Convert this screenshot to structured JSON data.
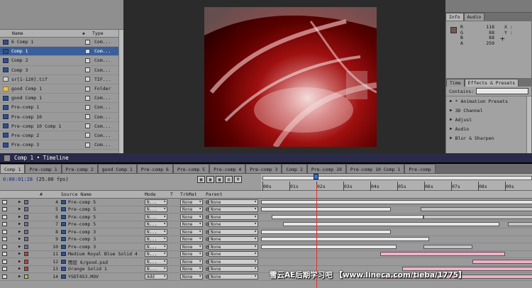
{
  "project": {
    "columns": {
      "name": "Name",
      "type": "Type"
    },
    "items": [
      {
        "name": "6 Comp 1",
        "type": "Com...",
        "icon": "comp-icon"
      },
      {
        "name": "Comp 1",
        "type": "Com...",
        "icon": "comp-icon"
      },
      {
        "name": "Comp 2",
        "type": "Com...",
        "icon": "comp-icon"
      },
      {
        "name": "Comp 3",
        "type": "Com...",
        "icon": "comp-icon"
      },
      {
        "name": "sr[1-120].tif",
        "type": "TIF...",
        "icon": "image-sequence-icon"
      },
      {
        "name": "good Comp 1",
        "type": "Folder",
        "icon": "folder-icon"
      },
      {
        "name": "good Comp 1",
        "type": "Com...",
        "icon": "comp-icon"
      },
      {
        "name": "Pre-comp 1",
        "type": "Com...",
        "icon": "comp-icon"
      },
      {
        "name": "Pre-comp 10",
        "type": "Com...",
        "icon": "comp-icon"
      },
      {
        "name": "Pre-comp 10 Comp 1",
        "type": "Com...",
        "icon": "comp-icon"
      },
      {
        "name": "Pre-comp 2",
        "type": "Com...",
        "icon": "comp-icon"
      },
      {
        "name": "Pre-comp 3",
        "type": "Com...",
        "icon": "comp-icon"
      }
    ]
  },
  "info": {
    "tabs": [
      "Info",
      "Audio"
    ],
    "values": [
      {
        "label": "R",
        "value": "118"
      },
      {
        "label": "G",
        "value": "88"
      },
      {
        "label": "B",
        "value": "88"
      },
      {
        "label": "A",
        "value": "250"
      }
    ],
    "x_label": "X :",
    "y_label": "Y :",
    "swatch_color": "#76584c"
  },
  "effects": {
    "tabs": [
      "Time",
      "Effects & Presets"
    ],
    "contains_label": "Contains:",
    "items": [
      "* Animation Presets",
      "3D Channel",
      "Adjust",
      "Audio",
      "Blur & Sharpen"
    ]
  },
  "timeline": {
    "title": "Comp 1 • Timeline",
    "tabs": [
      "Comp 1",
      "Pre-comp 1",
      "Pre-comp 2",
      "good Comp 1",
      "Pre-comp 6",
      "Pre-comp 5",
      "Pre-comp 4",
      "Pre-comp 3",
      "Comp 2",
      "Pre-comp 10",
      "Pre-comp 10 Comp 1",
      "Pre-comp"
    ],
    "timecode": "0:00:01:28",
    "fps": "(25.00 fps)",
    "ruler": [
      "00s",
      "01s",
      "02s",
      "03s",
      "04s",
      "05s",
      "06s",
      "07s",
      "08s",
      "09s"
    ],
    "columns": {
      "num": "#",
      "source": "Source Name",
      "mode": "Mode",
      "t": "T",
      "trkmat": "TrkMat",
      "parent": "Parent"
    },
    "layers": [
      {
        "num": "4",
        "name": "Pre-comp 5",
        "mode": "N...",
        "trkmat": "None",
        "parent": "None",
        "color": "#6e6e9e"
      },
      {
        "num": "5",
        "name": "Pre-comp 5",
        "mode": "N...",
        "trkmat": "None",
        "parent": "None",
        "color": "#6e6e9e"
      },
      {
        "num": "6",
        "name": "Pre-comp 5",
        "mode": "N...",
        "trkmat": "None",
        "parent": "None",
        "color": "#6e6e9e"
      },
      {
        "num": "7",
        "name": "Pre-comp 5",
        "mode": "N...",
        "trkmat": "None",
        "parent": "None",
        "color": "#6e6e9e"
      },
      {
        "num": "8",
        "name": "Pre-comp 3",
        "mode": "N...",
        "trkmat": "None",
        "parent": "None",
        "color": "#6e6e9e"
      },
      {
        "num": "9",
        "name": "Pre-comp 3",
        "mode": "N...",
        "trkmat": "None",
        "parent": "None",
        "color": "#6e6e9e"
      },
      {
        "num": "10",
        "name": "Pre-comp 3",
        "mode": "N...",
        "trkmat": "None",
        "parent": "None",
        "color": "#6e6e9e"
      },
      {
        "num": "11",
        "name": "Medium Royal Blue Solid 4",
        "mode": "N...",
        "trkmat": "None",
        "parent": "None",
        "color": "#c04040"
      },
      {
        "num": "12",
        "name": "图层 6/good.psd",
        "mode": "N...",
        "trkmat": "None",
        "parent": "None",
        "color": "#c04040"
      },
      {
        "num": "13",
        "name": "Orange Solid 1",
        "mode": "N...",
        "trkmat": "None",
        "parent": "None",
        "color": "#c04040"
      },
      {
        "num": "14",
        "name": "YSDT453.MOV",
        "mode": "Add",
        "trkmat": "None",
        "parent": "None",
        "color": "#c0c040"
      }
    ],
    "tracks": [
      [
        [
          0,
          1.05
        ]
      ],
      [
        [
          0,
          0.48
        ],
        [
          0.59,
          1.05
        ]
      ],
      [
        [
          0.04,
          0.6
        ],
        [
          0.6,
          1.05
        ]
      ],
      [
        [
          0.08,
          0.88
        ],
        [
          0.91,
          1.05
        ]
      ],
      [
        [
          0,
          0.48
        ]
      ],
      [
        [
          0,
          0.62
        ]
      ],
      [
        [
          0,
          0.5
        ],
        [
          0.6,
          0.78
        ]
      ],
      [
        [
          0.44,
          0.9
        ]
      ],
      [
        [
          0.78,
          1.05
        ]
      ],
      [
        [
          0.52,
          1.05
        ]
      ],
      [
        [
          0.44,
          1.05
        ]
      ]
    ]
  },
  "watermark": "雪云AE后期学习吧 【www.lineca.com/tieba/1775】"
}
